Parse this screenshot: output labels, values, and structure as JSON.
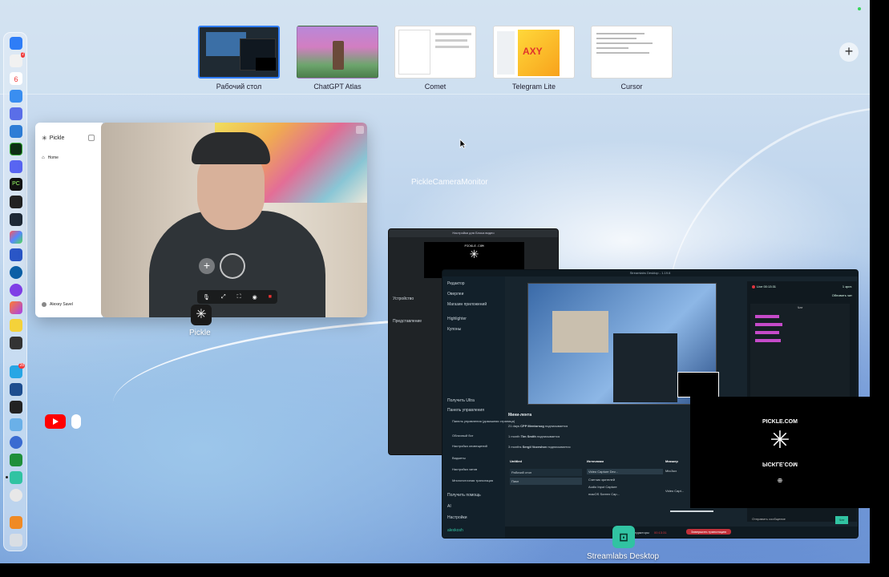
{
  "spaces": [
    {
      "label": "Рабочий стол",
      "active": true
    },
    {
      "label": "ChatGPT Atlas",
      "active": false
    },
    {
      "label": "Comet",
      "active": false
    },
    {
      "label": "Telegram Lite",
      "active": false
    },
    {
      "label": "Cursor",
      "active": false
    }
  ],
  "add_space_symbol": "+",
  "pickle": {
    "app_label": "Pickle",
    "sidebar_brand": "Pickle",
    "sidebar_home": "Home",
    "sidebar_user": "Alexey Savel",
    "video_name_tag": "",
    "overlay_brand": "PICKLE.COM",
    "overlay_brand_mirrored": "PICKLE.COM"
  },
  "camera_monitor_label": "PickleCameraMonitor",
  "settings": {
    "title": "Настройки для Блока видео",
    "section_device": "Устройство",
    "section_presentation": "Представление"
  },
  "streamlabs": {
    "app_label": "Streamlabs Desktop",
    "title": "Streamlabs Desktop - 1.19.6",
    "sidebar_items": [
      "Редактор",
      "Оверлеи",
      "Магазин приложений",
      "Highlighter",
      "Купоны"
    ],
    "sidebar_bottom": [
      "Получить Ultra",
      "Панель управления",
      "Панель управления (домашняя страница)",
      "Облачный бот",
      "Настройка оповещений",
      "Виджеты",
      "Настройка чатов",
      "Многопоточная трансляция",
      "Получить помощь",
      "AI",
      "Настройки"
    ],
    "user": "alexkosh",
    "live_time": "Live 00:13:31",
    "viewers": "1 зрит.",
    "update_chat": "Обновить чат",
    "chat_title": "Чат",
    "feed_title": "Мини-лента",
    "feed": [
      {
        "time": "21 days",
        "user": "CPP Mentorsog",
        "text": "подписывается"
      },
      {
        "time": "1 month",
        "user": "Tim Smith",
        "text": "подписывается"
      },
      {
        "time": "3 months",
        "user": "Sergii Vozeshov",
        "text": "подписывается"
      }
    ],
    "scenes_title": "Untitled",
    "scenes": [
      "Рабочий стол",
      "Пикл"
    ],
    "sources_title": "Источники",
    "sources": [
      "Video Capture Dev...",
      "Счетчик зрителей",
      "Audio Input Capture",
      "macOS Screen Cap..."
    ],
    "mixer_title": "Микшер",
    "mixer_items": [
      "Mic/Aux",
      "Video Capt..."
    ],
    "chat_placeholder": "Отправить сообщение",
    "chat_send": "Чат",
    "footer_time": "00:13:31",
    "footer_end": "Завершить трансляцию",
    "footer_left": "редакторы"
  },
  "colors": {
    "accent": "#2f7cf6",
    "streamlabs_teal": "#31c3a2",
    "live_red": "#e0353f",
    "youtube_red": "#ff0000"
  }
}
